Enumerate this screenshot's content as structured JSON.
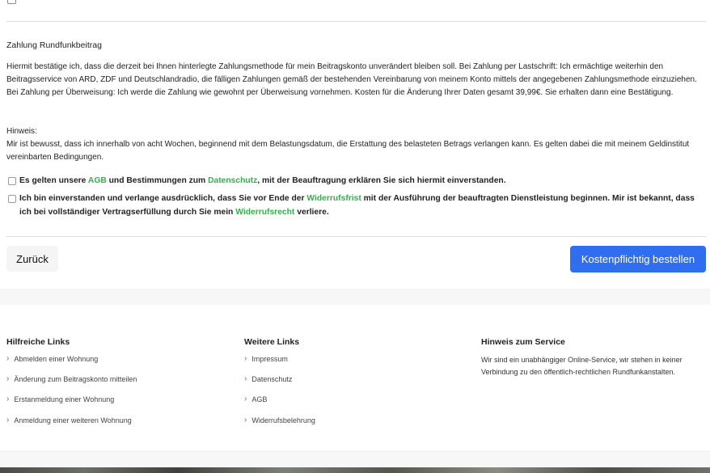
{
  "summary": {
    "heading": "Zahlung Rundfunkbeitrag",
    "paragraph1": "Hiermit bestätige ich, dass die derzeit bei Ihnen hinterlegte Zahlungsmethode für mein Beitragskonto unverändert bleiben soll. Bei Zahlung per Lastschrift: Ich ermächtige weiterhin den Beitragsservice von ARD, ZDF und Deutschlandradio, die fälligen Zahlungen gemäß der bestehenden Vereinbarung von meinem Konto mittels der angegebenen Zahlungsmethode einzuziehen. Bei Zahlung per Überweisung: Ich werde die Zahlung wie gewohnt per Überweisung vornehmen. Kosten für die Änderung Ihrer Daten gesamt 39,99€. Sie erhalten dann eine Bestätigung.",
    "hint_label": "Hinweis:",
    "hint_text": "Mir ist bewusst, dass ich innerhalb von acht Wochen, beginnend mit dem Belastungsdatum, die Erstattung des belasteten Betrags verlangen kann. Es gelten dabei die mit meinem Geldinstitut vereinbarten Bedingungen."
  },
  "consent1": {
    "part1": "Es gelten unsere ",
    "link1": "AGB",
    "part2": " und Bestimmungen zum ",
    "link2": "Datenschutz",
    "part3": ", mit der Beauftragung erklären Sie sich hiermit einverstanden."
  },
  "consent2": {
    "part1": "Ich bin einverstanden und verlange ausdrücklich, dass Sie vor Ende der ",
    "link1": "Widerrufsfrist",
    "part2": " mit der Ausführung der beauftragten Dienstleistung beginnen. Mir ist bekannt, dass ich bei vollständiger Vertragserfüllung durch Sie mein ",
    "link2": "Widerrufsrecht",
    "part3": " verliere."
  },
  "actions": {
    "back_label": "Zurück",
    "order_label": "Kostenpflichtig bestellen"
  },
  "footer": {
    "col1": {
      "title": "Hilfreiche Links",
      "links": [
        "Abmelden einer Wohnung",
        "Änderung zum Beitragskonto mitteilen",
        "Erstanmeldung einer Wohnung",
        "Anmeldung einer weiteren Wohnung"
      ]
    },
    "col2": {
      "title": "Weitere Links",
      "links": [
        "Impressum",
        "Datenschutz",
        "AGB",
        "Widerrufsbelehrung"
      ]
    },
    "col3": {
      "title": "Hinweis zum Service",
      "text": "Wir sind ein unabhängiger Online-Service, wir stehen in keiner Verbindung zu den öffentlich-rechtlichen Rundfunkanstalten."
    }
  },
  "colors": {
    "link_green": "#32b14a",
    "primary_blue": "#2f6fef"
  }
}
